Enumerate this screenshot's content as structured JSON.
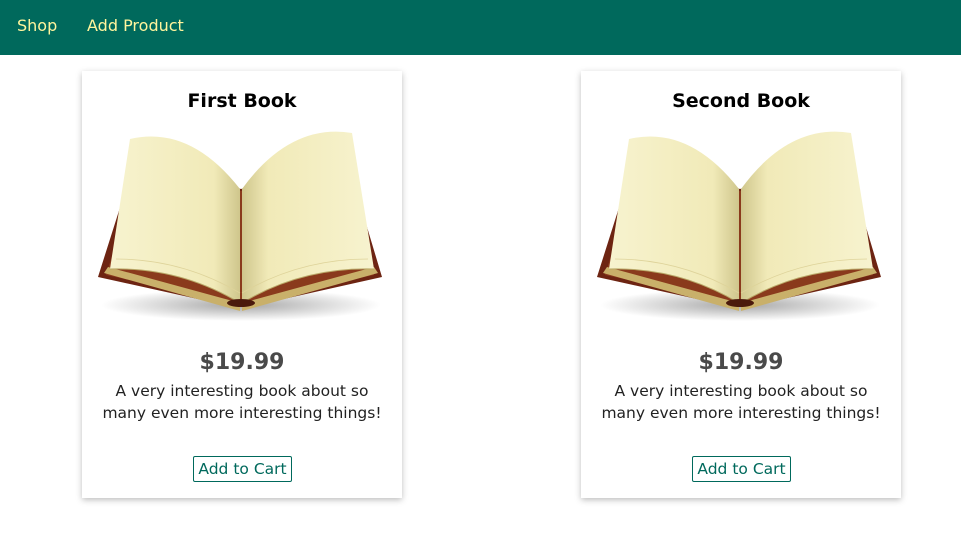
{
  "header": {
    "nav": [
      {
        "label": "Shop"
      },
      {
        "label": "Add Product"
      }
    ],
    "background_color": "#00695c",
    "link_color": "#fff59d"
  },
  "products": [
    {
      "title": "First Book",
      "price": "$19.99",
      "description": "A very interesting book about so many even more interesting things!",
      "button_label": "Add to Cart",
      "image_icon": "open-book-icon"
    },
    {
      "title": "Second Book",
      "price": "$19.99",
      "description": "A very interesting book about so many even more interesting things!",
      "button_label": "Add to Cart",
      "image_icon": "open-book-icon"
    }
  ]
}
